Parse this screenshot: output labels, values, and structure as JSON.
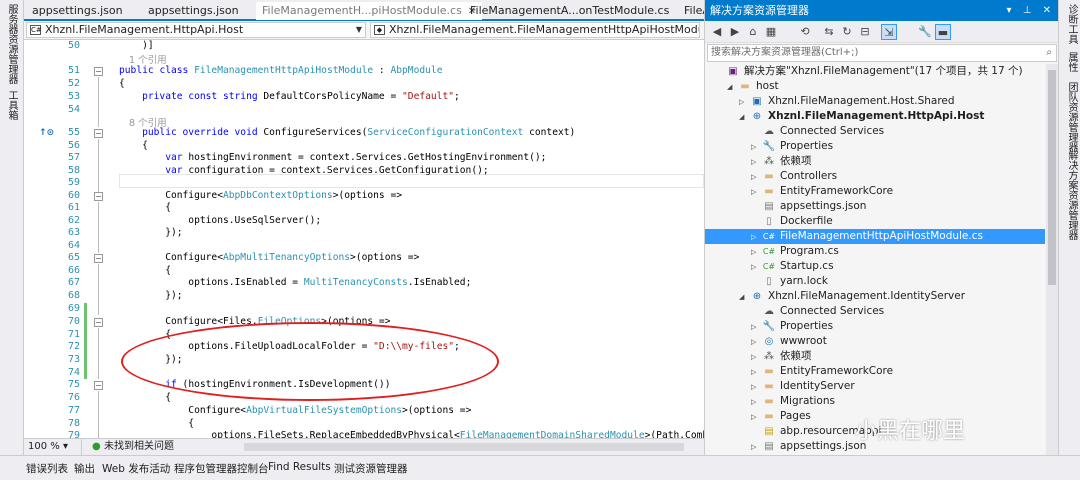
{
  "left_strip": [
    "服务器资源管理器",
    "工具箱"
  ],
  "right_strip": [
    "诊断工具",
    "属性",
    "团队资源管理器",
    "解决方案资源管理器"
  ],
  "doc_tabs": [
    {
      "label": "appsettings.json",
      "active": false
    },
    {
      "label": "appsettings.json",
      "active": false
    },
    {
      "label": "FileManagementH...piHostModule.cs",
      "active": true,
      "close": "✕"
    },
    {
      "label": "FileManagementA...onTestModule.cs",
      "active": false
    },
    {
      "label": "FileA",
      "active": false
    }
  ],
  "nav": {
    "project": "Xhznl.FileManagement.HttpApi.Host",
    "type": "Xhznl.FileManagement.FileManagementHttpApiHostModule"
  },
  "code": {
    "refs": {
      "r1": "1 个引用",
      "r2": "8 个引用"
    },
    "line_numbers": [
      "50",
      "51",
      "52",
      "53",
      "54",
      "55",
      "56",
      "57",
      "58",
      "59",
      "60",
      "61",
      "62",
      "63",
      "64",
      "65",
      "66",
      "67",
      "68",
      "69",
      "70",
      "71",
      "72",
      "73",
      "74",
      "75",
      "76",
      "77",
      "78",
      "79"
    ],
    "lines": {
      "l50": "    )]",
      "l51a": "public ",
      "l51b": "class ",
      "l51c": "FileManagementHttpApiHostModule",
      "l51d": " : ",
      "l51e": "AbpModule",
      "l52": "{",
      "l53a": "    private const string ",
      "l53b": "DefaultCorsPolicyName = ",
      "l53c": "\"Default\"",
      "l53d": ";",
      "l55a": "    public override void ",
      "l55b": "ConfigureServices(",
      "l55c": "ServiceConfigurationContext",
      "l55d": " context)",
      "l56": "    {",
      "l57a": "        var ",
      "l57b": "hostingEnvironment = context.Services.GetHostingEnvironment();",
      "l58a": "        var ",
      "l58b": "configuration = context.Services.GetConfiguration();",
      "l60a": "        Configure<",
      "l60b": "AbpDbContextOptions",
      "l60c": ">(options =>",
      "l61": "        {",
      "l62": "            options.UseSqlServer();",
      "l63": "        });",
      "l65a": "        Configure<",
      "l65b": "AbpMultiTenancyOptions",
      "l65c": ">(options =>",
      "l66": "        {",
      "l67a": "            options.IsEnabled = ",
      "l67b": "MultiTenancyConsts",
      "l67c": ".IsEnabled;",
      "l68": "        });",
      "l70a": "        Configure<Files.",
      "l70b": "FileOptions",
      "l70c": ">(options =>",
      "l71": "        {",
      "l72a": "            options.FileUploadLocalFolder = ",
      "l72b": "\"D:\\\\my-files\"",
      "l72c": ";",
      "l73": "        });",
      "l75a": "        if ",
      "l75b": "(hostingEnvironment.IsDevelopment())",
      "l76": "        {",
      "l77a": "            Configure<",
      "l77b": "AbpVirtualFileSystemOptions",
      "l77c": ">(options =>",
      "l78": "            {",
      "l79a": "                options.FileSets.ReplaceEmbeddedByPhysical<",
      "l79b": "FileManagementDomainSharedModule",
      "l79c": ">(Path.Combine"
    },
    "gutter_mark": "↑⊙"
  },
  "editor_status": {
    "zoom": "100 %",
    "issues": "未找到相关问题"
  },
  "solution_explorer": {
    "title": "解决方案资源管理器",
    "search_placeholder": "搜索解决方案资源管理器(Ctrl+;)",
    "nodes": [
      {
        "label": "解决方案\"Xhznl.FileManagement\"(17 个项目，共 17 个)",
        "icon": "sln",
        "depth": 0,
        "arrow": ""
      },
      {
        "label": "host",
        "icon": "folder",
        "depth": 1,
        "arrow": "◢"
      },
      {
        "label": "Xhznl.FileManagement.Host.Shared",
        "icon": "csproj",
        "depth": 2,
        "arrow": "▷"
      },
      {
        "label": "Xhznl.FileManagement.HttpApi.Host",
        "icon": "web",
        "depth": 2,
        "arrow": "◢",
        "bold": true
      },
      {
        "label": "Connected Services",
        "icon": "conn",
        "depth": 3,
        "arrow": ""
      },
      {
        "label": "Properties",
        "icon": "props",
        "depth": 3,
        "arrow": "▷"
      },
      {
        "label": "依赖项",
        "icon": "deps",
        "depth": 3,
        "arrow": "▷"
      },
      {
        "label": "Controllers",
        "icon": "folder",
        "depth": 3,
        "arrow": "▷"
      },
      {
        "label": "EntityFrameworkCore",
        "icon": "folder",
        "depth": 3,
        "arrow": "▷"
      },
      {
        "label": "appsettings.json",
        "icon": "json",
        "depth": 3,
        "arrow": ""
      },
      {
        "label": "Dockerfile",
        "icon": "file",
        "depth": 3,
        "arrow": ""
      },
      {
        "label": "FileManagementHttpApiHostModule.cs",
        "icon": "cs",
        "depth": 3,
        "arrow": "▷",
        "selected": true
      },
      {
        "label": "Program.cs",
        "icon": "cs",
        "depth": 3,
        "arrow": "▷"
      },
      {
        "label": "Startup.cs",
        "icon": "cs",
        "depth": 3,
        "arrow": "▷"
      },
      {
        "label": "yarn.lock",
        "icon": "file",
        "depth": 3,
        "arrow": ""
      },
      {
        "label": "Xhznl.FileManagement.IdentityServer",
        "icon": "web",
        "depth": 2,
        "arrow": "◢"
      },
      {
        "label": "Connected Services",
        "icon": "conn",
        "depth": 3,
        "arrow": ""
      },
      {
        "label": "Properties",
        "icon": "props",
        "depth": 3,
        "arrow": "▷"
      },
      {
        "label": "wwwroot",
        "icon": "globe",
        "depth": 3,
        "arrow": "▷"
      },
      {
        "label": "依赖项",
        "icon": "deps",
        "depth": 3,
        "arrow": "▷"
      },
      {
        "label": "EntityFrameworkCore",
        "icon": "folder",
        "depth": 3,
        "arrow": "▷"
      },
      {
        "label": "IdentityServer",
        "icon": "folder",
        "depth": 3,
        "arrow": "▷"
      },
      {
        "label": "Migrations",
        "icon": "folder",
        "depth": 3,
        "arrow": "▷"
      },
      {
        "label": "Pages",
        "icon": "folder",
        "depth": 3,
        "arrow": "▷"
      },
      {
        "label": "abp.resourcemappi",
        "icon": "js",
        "depth": 3,
        "arrow": ""
      },
      {
        "label": "appsettings.json",
        "icon": "json",
        "depth": 3,
        "arrow": "▷"
      }
    ]
  },
  "watermark": "小黑在哪里",
  "bottom_tabs": [
    "错误列表",
    "输出",
    "Web 发布活动",
    "程序包管理器控制台",
    "Find Results",
    "测试资源管理器"
  ]
}
